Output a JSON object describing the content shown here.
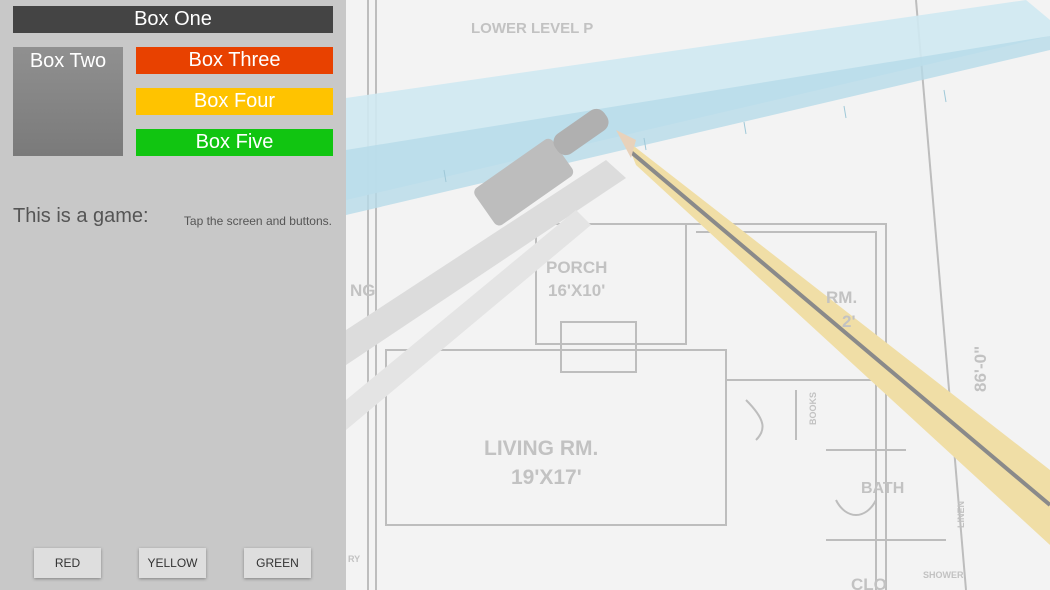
{
  "boxes": {
    "one": "Box One",
    "two": "Box Two",
    "three": "Box Three",
    "four": "Box Four",
    "five": "Box Five"
  },
  "game": {
    "label": "This is a game:",
    "hint": "Tap the screen and buttons."
  },
  "buttons": {
    "red": "RED",
    "yellow": "YELLOW",
    "green": "GREEN"
  },
  "colors": {
    "panel": "#c8c8c8",
    "box_one": "#444444",
    "box_two": "#858585",
    "box_three": "#e84100",
    "box_four": "#ffc300",
    "box_five": "#11c511"
  },
  "blueprint": {
    "lower_level": "LOWER LEVEL P",
    "porch": "PORCH",
    "porch_size": "16'X10'",
    "living": "LIVING RM.",
    "living_size": "19'X17'",
    "rm": "RM.",
    "rm_digit": "2'",
    "bath": "BATH",
    "books": "BOOKS",
    "linen": "LINEN",
    "shower": "SHOWER",
    "clo": "CLO",
    "ng": "NG",
    "ry": "RY",
    "dimension": "86'-0\""
  }
}
